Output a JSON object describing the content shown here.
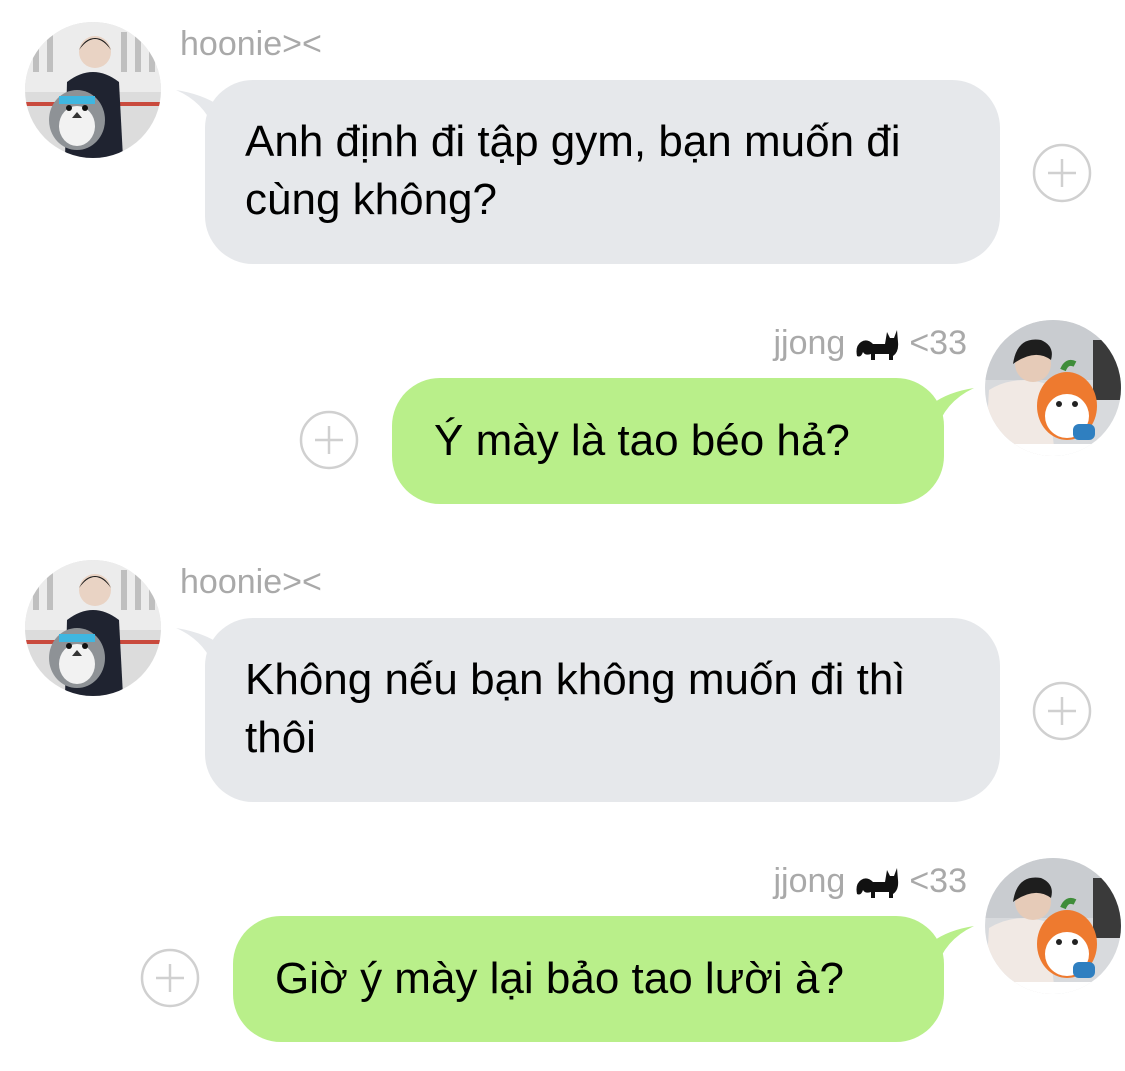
{
  "colors": {
    "incoming_bubble": "#e6e8eb",
    "outgoing_bubble": "#b9ef8a",
    "name_text": "#a9a9a9",
    "plus_icon": "#d0d0d0"
  },
  "messages": [
    {
      "sender": "hoonie><",
      "direction": "incoming",
      "text": "Anh định đi tập gym, bạn muốn đi cùng không?",
      "icon": "add-reaction-icon"
    },
    {
      "sender": "jjong",
      "sender_suffix": "<33",
      "sender_emoji": "black-cat-icon",
      "direction": "outgoing",
      "text": "Ý mày là tao béo hả?",
      "icon": "add-reaction-icon"
    },
    {
      "sender": "hoonie><",
      "direction": "incoming",
      "text": "Không nếu bạn không muốn đi thì thôi",
      "icon": "add-reaction-icon"
    },
    {
      "sender": "jjong",
      "sender_suffix": "<33",
      "sender_emoji": "black-cat-icon",
      "direction": "outgoing",
      "text": "Giờ ý mày lại bảo tao lười à?",
      "icon": "add-reaction-icon"
    }
  ]
}
